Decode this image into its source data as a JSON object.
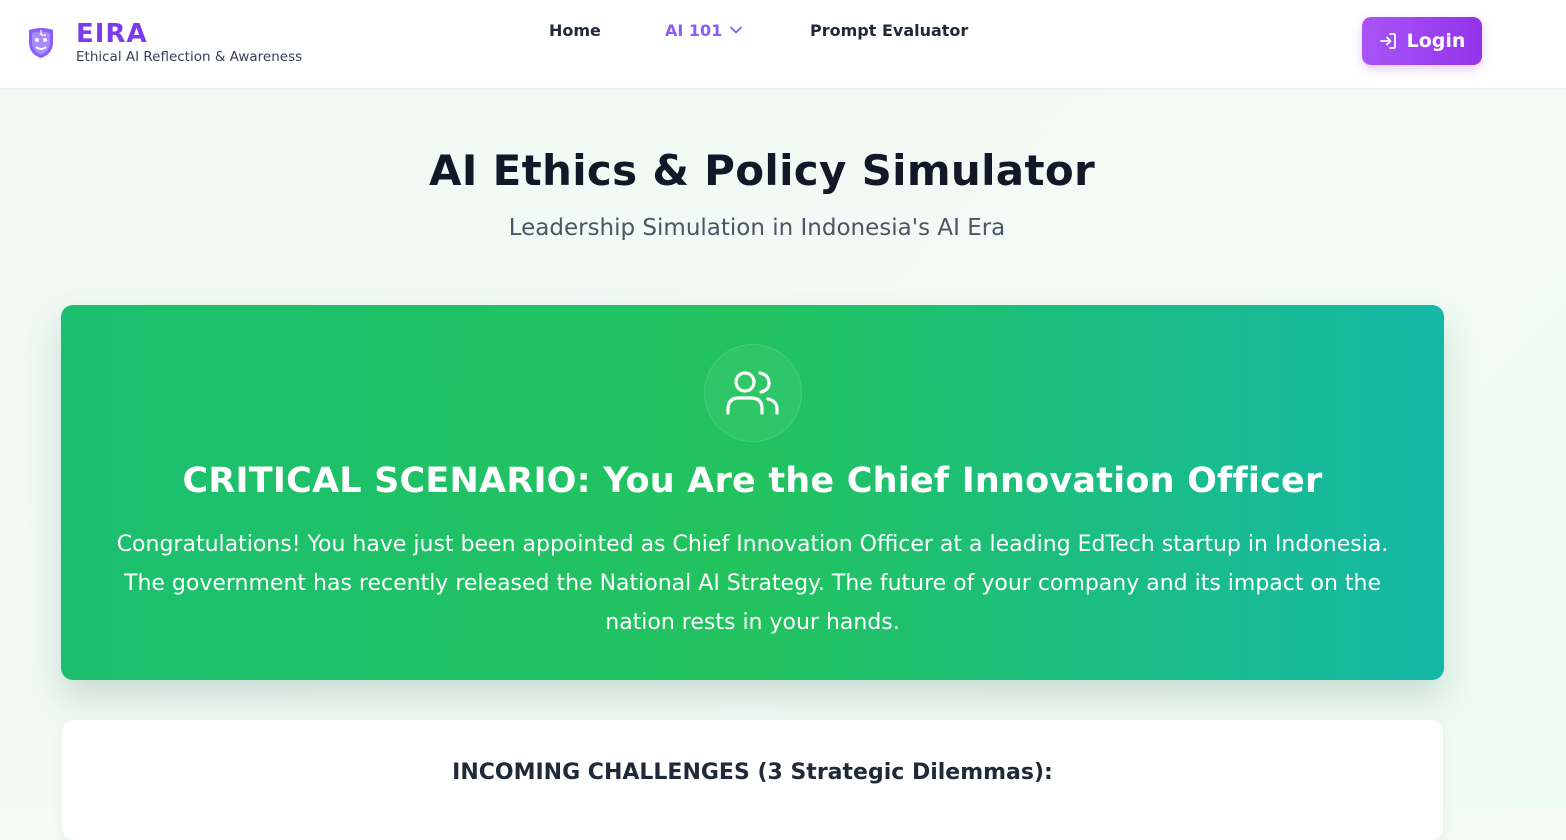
{
  "brand": {
    "name": "EIRA",
    "tagline": "Ethical AI Reflection & Awareness",
    "logo_icon": "theater-mask-circuit-icon"
  },
  "nav": {
    "items": [
      {
        "label": "Home"
      },
      {
        "label": "AI 101",
        "active": true,
        "has_dropdown": true
      },
      {
        "label": "Prompt Evaluator"
      }
    ],
    "login_label": "Login",
    "login_icon": "login-arrow-icon"
  },
  "page": {
    "title": "AI Ethics & Policy Simulator",
    "subtitle": "Leadership Simulation in Indonesia's AI Era"
  },
  "scenario": {
    "icon": "users-icon",
    "title": "CRITICAL SCENARIO: You Are the Chief Innovation Officer",
    "description": "Congratulations! You have just been appointed as Chief Innovation Officer at a leading EdTech startup in Indonesia. The government has recently released the National AI Strategy. The future of your company and its impact on the nation rests in your hands."
  },
  "challenges": {
    "title": "INCOMING CHALLENGES (3 Strategic Dilemmas):"
  },
  "colors": {
    "brand_purple": "#7c3aed",
    "accent_purple": "#9333ea",
    "scenario_green": "#22c35e",
    "scenario_teal": "#14b8a6"
  }
}
